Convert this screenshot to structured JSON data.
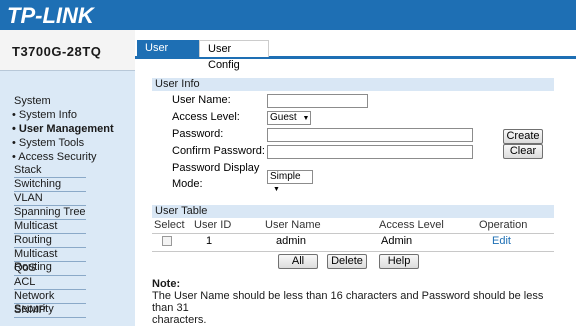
{
  "header": {
    "brand": "TP-LINK"
  },
  "sidebar": {
    "model": "T3700G-28TQ",
    "items": [
      {
        "label": "System"
      },
      {
        "label": "• System Info"
      },
      {
        "label": "• User Management"
      },
      {
        "label": "• System Tools"
      },
      {
        "label": "• Access Security"
      },
      {
        "label": "Stack"
      },
      {
        "label": "Switching"
      },
      {
        "label": "VLAN"
      },
      {
        "label": "Spanning Tree"
      },
      {
        "label": "Multicast"
      },
      {
        "label": "Routing"
      },
      {
        "label": "Multicast Routing"
      },
      {
        "label": "QoS"
      },
      {
        "label": "ACL"
      },
      {
        "label": "Network Security"
      },
      {
        "label": "SNMP"
      }
    ]
  },
  "tabs": [
    {
      "label": "User Table"
    },
    {
      "label": "User Config"
    }
  ],
  "user_info": {
    "title": "User Info",
    "username_label": "User Name:",
    "access_level_label": "Access Level:",
    "access_level_value": "Guest",
    "password_label": "Password:",
    "confirm_label": "Confirm Password:",
    "display_label_1": "Password Display",
    "display_label_2": "Mode:",
    "display_value": "Simple",
    "create_button": "Create",
    "clear_button": "Clear"
  },
  "user_table": {
    "title": "User Table",
    "headers": [
      "Select",
      "User ID",
      "User Name",
      "Access Level",
      "Operation"
    ],
    "rows": [
      {
        "id": "1",
        "name": "admin",
        "level": "Admin",
        "op": "Edit"
      }
    ],
    "buttons": {
      "all": "All",
      "delete": "Delete",
      "help": "Help"
    }
  },
  "note": {
    "title": "Note:",
    "line1": "The User Name should be less than 16 characters and Password should be less than 31",
    "line2": "characters."
  },
  "colors": {
    "header": "#1e6fb4",
    "sidebar": "#dbe9f6",
    "section": "#d9e7f5",
    "link": "#1e6fb4"
  }
}
